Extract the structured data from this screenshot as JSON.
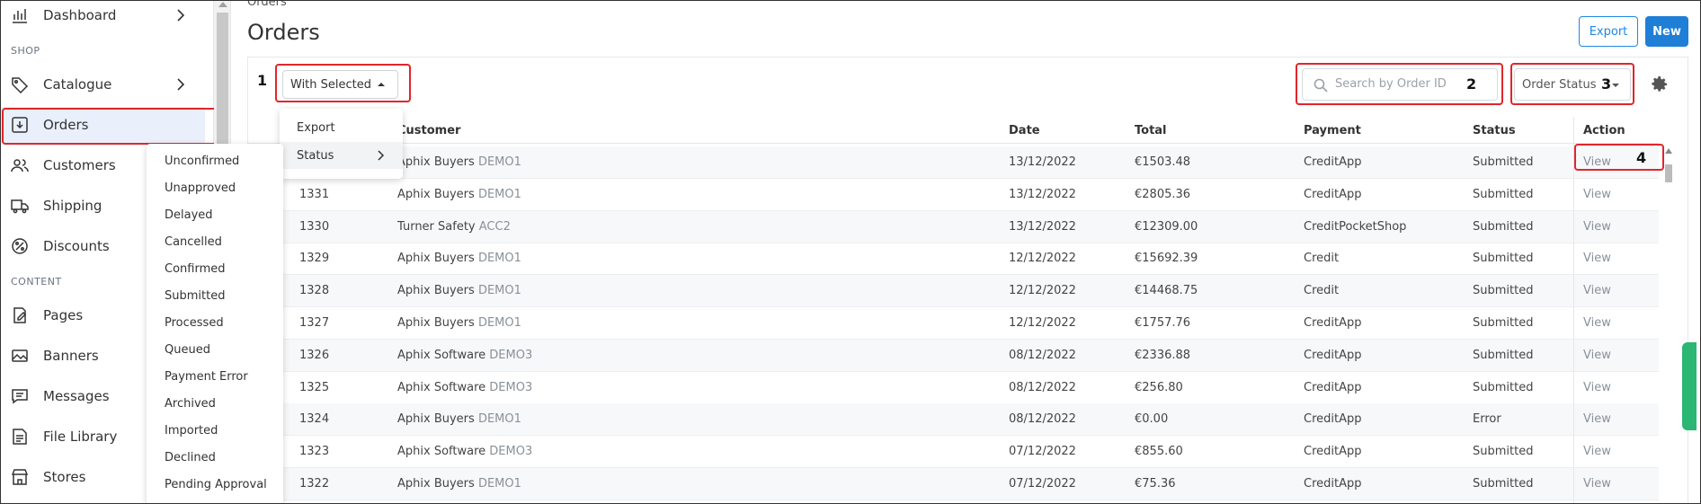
{
  "sidebar": {
    "items": [
      {
        "label": "Dashboard"
      },
      {
        "label": "Catalogue"
      },
      {
        "label": "Orders"
      },
      {
        "label": "Customers"
      },
      {
        "label": "Shipping"
      },
      {
        "label": "Discounts"
      },
      {
        "label": "Pages"
      },
      {
        "label": "Banners"
      },
      {
        "label": "Messages"
      },
      {
        "label": "File Library"
      },
      {
        "label": "Stores"
      }
    ],
    "sections": {
      "shop": "SHOP",
      "content": "CONTENT"
    }
  },
  "header": {
    "breadcrumb": "Orders",
    "title": "Orders",
    "export_label": "Export",
    "new_label": "New"
  },
  "toolbar": {
    "with_selected_label": "With Selected",
    "search_placeholder": "Search by Order ID",
    "order_status_label": "Order Status"
  },
  "with_selected_menu": {
    "items": [
      {
        "label": "Export"
      },
      {
        "label": "Status"
      }
    ]
  },
  "status_submenu": {
    "items": [
      "Unconfirmed",
      "Unapproved",
      "Delayed",
      "Cancelled",
      "Confirmed",
      "Submitted",
      "Processed",
      "Queued",
      "Payment Error",
      "Archived",
      "Imported",
      "Declined",
      "Pending Approval"
    ]
  },
  "annotations": [
    "1",
    "2",
    "3",
    "4"
  ],
  "table": {
    "columns": [
      "Customer",
      "Date",
      "Total",
      "Payment",
      "Status",
      "Action"
    ],
    "rows": [
      {
        "id": "",
        "customer": "Aphix Buyers",
        "code": "DEMO1",
        "date": "13/12/2022",
        "total": "€1503.48",
        "payment": "CreditApp",
        "status": "Submitted",
        "action": "View"
      },
      {
        "id": "1331",
        "customer": "Aphix Buyers",
        "code": "DEMO1",
        "date": "13/12/2022",
        "total": "€2805.36",
        "payment": "CreditApp",
        "status": "Submitted",
        "action": "View"
      },
      {
        "id": "1330",
        "customer": "Turner Safety",
        "code": "ACC2",
        "date": "13/12/2022",
        "total": "€12309.00",
        "payment": "CreditPocketShop",
        "status": "Submitted",
        "action": "View"
      },
      {
        "id": "1329",
        "customer": "Aphix Buyers",
        "code": "DEMO1",
        "date": "12/12/2022",
        "total": "€15692.39",
        "payment": "Credit",
        "status": "Submitted",
        "action": "View"
      },
      {
        "id": "1328",
        "customer": "Aphix Buyers",
        "code": "DEMO1",
        "date": "12/12/2022",
        "total": "€14468.75",
        "payment": "Credit",
        "status": "Submitted",
        "action": "View"
      },
      {
        "id": "1327",
        "customer": "Aphix Buyers",
        "code": "DEMO1",
        "date": "12/12/2022",
        "total": "€1757.76",
        "payment": "CreditApp",
        "status": "Submitted",
        "action": "View"
      },
      {
        "id": "1326",
        "customer": "Aphix Software",
        "code": "DEMO3",
        "date": "08/12/2022",
        "total": "€2336.88",
        "payment": "CreditApp",
        "status": "Submitted",
        "action": "View"
      },
      {
        "id": "1325",
        "customer": "Aphix Software",
        "code": "DEMO3",
        "date": "08/12/2022",
        "total": "€256.80",
        "payment": "CreditApp",
        "status": "Submitted",
        "action": "View"
      },
      {
        "id": "1324",
        "customer": "Aphix Buyers",
        "code": "DEMO1",
        "date": "08/12/2022",
        "total": "€0.00",
        "payment": "CreditApp",
        "status": "Error",
        "action": "View"
      },
      {
        "id": "1323",
        "customer": "Aphix Software",
        "code": "DEMO3",
        "date": "07/12/2022",
        "total": "€855.60",
        "payment": "CreditApp",
        "status": "Submitted",
        "action": "View"
      },
      {
        "id": "1322",
        "customer": "Aphix Buyers",
        "code": "DEMO1",
        "date": "07/12/2022",
        "total": "€75.36",
        "payment": "CreditApp",
        "status": "Submitted",
        "action": "View"
      }
    ]
  },
  "colors": {
    "accent": "#1f7ed6",
    "annotation": "#e0262b",
    "active_nav": "#e9f0fb"
  }
}
